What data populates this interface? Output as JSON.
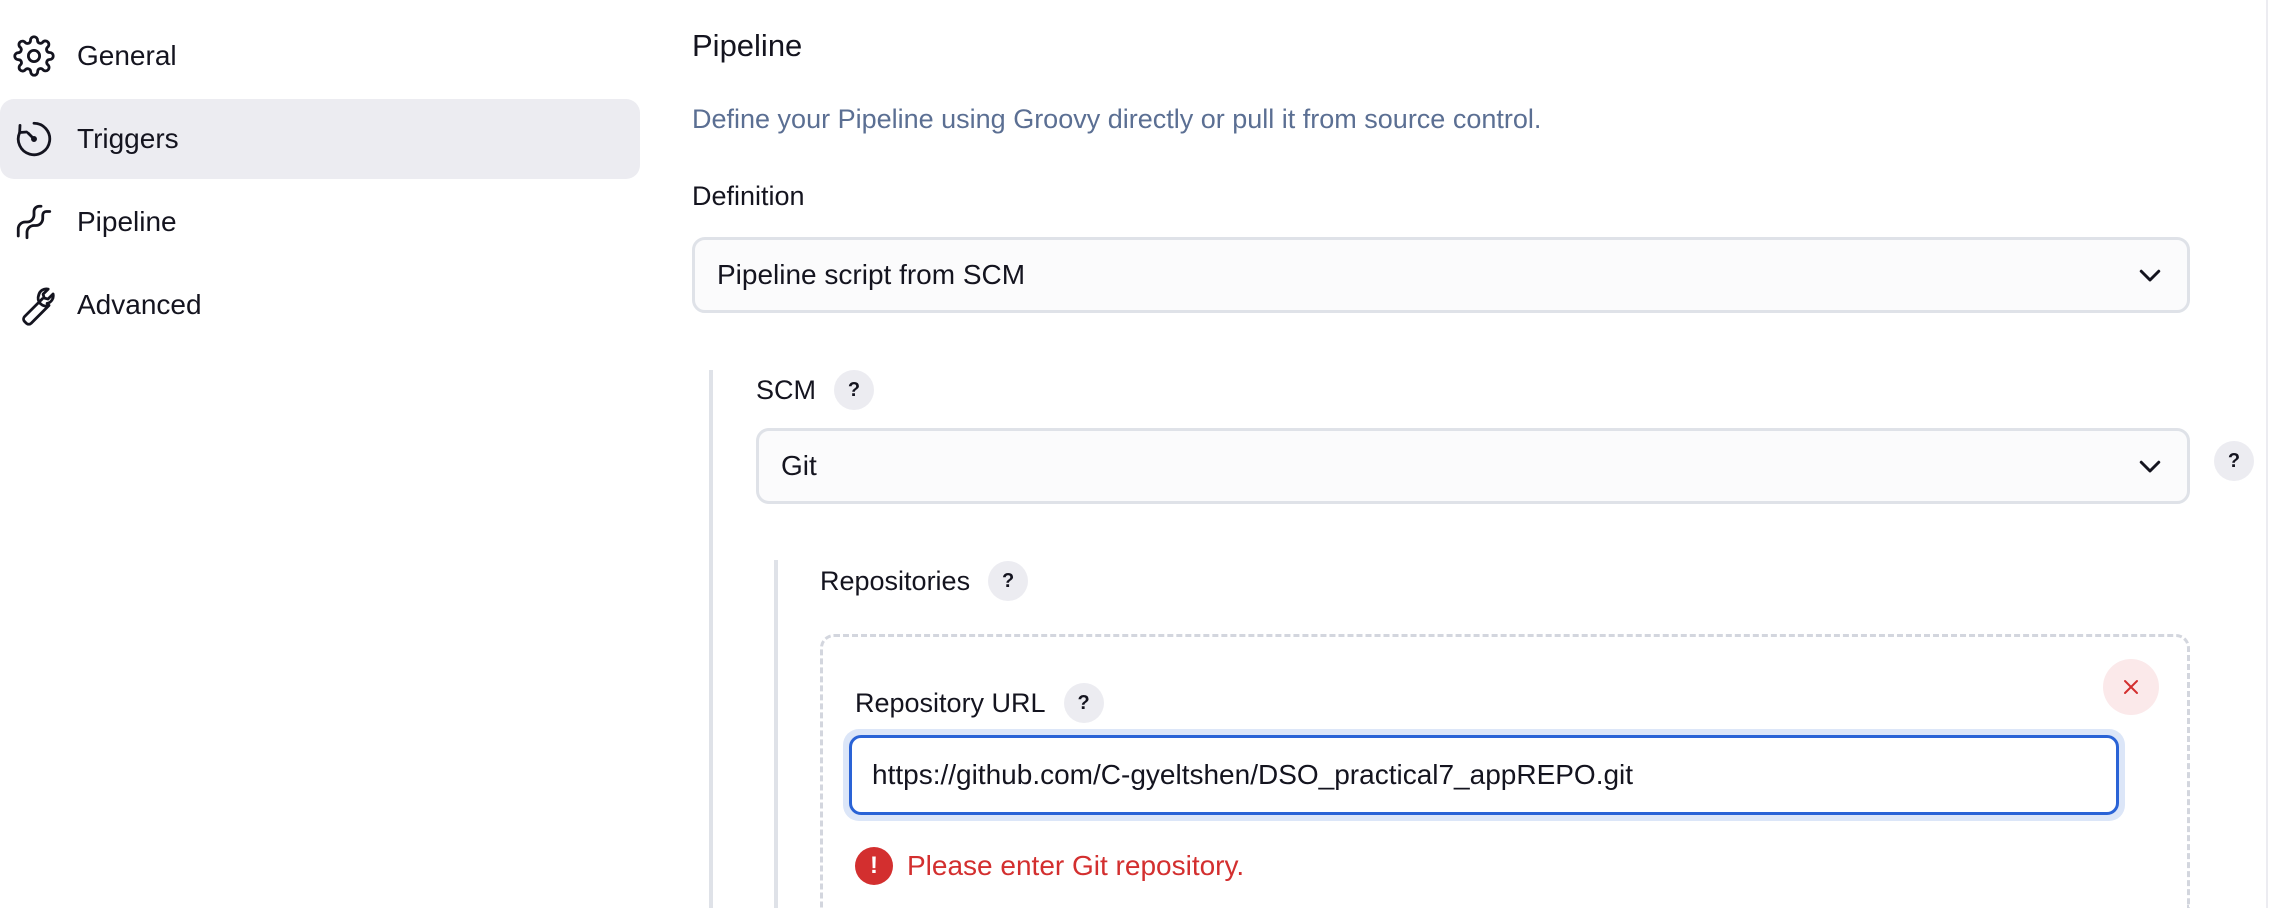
{
  "sidebar": {
    "items": [
      {
        "label": "General",
        "icon": "gear-icon",
        "active": false
      },
      {
        "label": "Triggers",
        "icon": "timer-icon",
        "active": true
      },
      {
        "label": "Pipeline",
        "icon": "pipeline-icon",
        "active": false
      },
      {
        "label": "Advanced",
        "icon": "wrench-icon",
        "active": false
      }
    ]
  },
  "main": {
    "title": "Pipeline",
    "description": "Define your Pipeline using Groovy directly or pull it from source control.",
    "definition": {
      "label": "Definition",
      "selected": "Pipeline script from SCM"
    },
    "scm": {
      "label": "SCM",
      "help": "?",
      "selected": "Git"
    },
    "repositories": {
      "label": "Repositories",
      "help": "?",
      "repo_url": {
        "label": "Repository URL",
        "help": "?",
        "value": "https://github.com/C-gyeltshen/DSO_practical7_appREPO.git"
      },
      "error": {
        "icon": "!",
        "message": "Please enter Git repository."
      }
    }
  },
  "colors": {
    "accent": "#2a63d6",
    "error": "#d32f2f",
    "muted_text": "#5b6f93",
    "active_bg": "#ececf1"
  }
}
